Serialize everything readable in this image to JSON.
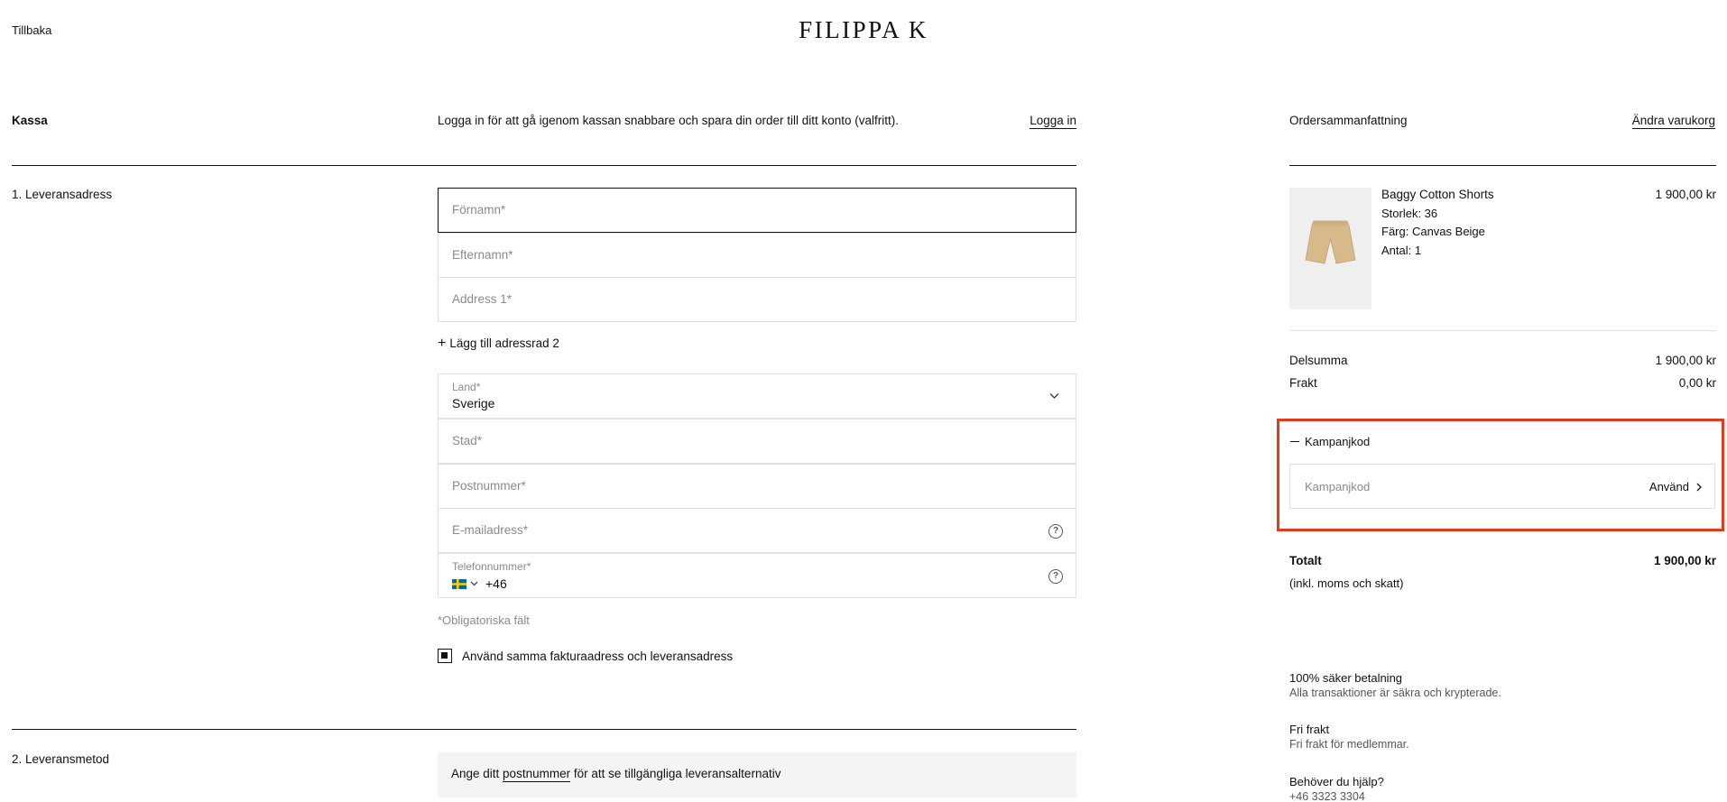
{
  "header": {
    "back_label": "Tillbaka",
    "brand": "FILIPPA K"
  },
  "checkout": {
    "title": "Kassa",
    "login_prompt": "Logga in för att gå igenom kassan snabbare och spara din order till ditt konto (valfritt).",
    "login_link": "Logga in"
  },
  "shipping_address": {
    "section_title": "1. Leveransadress",
    "first_name_placeholder": "Förnamn*",
    "last_name_placeholder": "Efternamn*",
    "address1_placeholder": "Address 1*",
    "add_address2_label": "Lägg till adressrad 2",
    "country_label": "Land*",
    "country_value": "Sverige",
    "city_placeholder": "Stad*",
    "postal_placeholder": "Postnummer*",
    "email_placeholder": "E-mailadress*",
    "phone_label": "Telefonnummer*",
    "phone_prefix": "+46",
    "required_note": "*Obligatoriska fält",
    "same_address_label": "Använd samma fakturaadress och leveransadress",
    "same_address_checked": true
  },
  "delivery_method": {
    "section_title": "2. Leveransmetod",
    "notice_before": "Ange ditt ",
    "notice_link": "postnummer",
    "notice_after": " för att se tillgängliga leveransalternativ"
  },
  "order_summary": {
    "title": "Ordersammanfattning",
    "edit_cart_link": "Ändra varukorg",
    "item": {
      "name": "Baggy Cotton Shorts",
      "size": "Storlek: 36",
      "color": "Färg: Canvas Beige",
      "quantity": "Antal: 1",
      "price": "1 900,00 kr"
    },
    "subtotal_label": "Delsumma",
    "subtotal_value": "1 900,00 kr",
    "shipping_label": "Frakt",
    "shipping_value": "0,00 kr",
    "promo_toggle_label": "Kampanjkod",
    "promo_placeholder": "Kampanjkod",
    "promo_apply_label": "Använd",
    "total_label": "Totalt",
    "total_value": "1 900,00 kr",
    "total_note": "(inkl. moms och skatt)"
  },
  "info": {
    "secure_title": "100% säker betalning",
    "secure_text": "Alla transaktioner är säkra och krypterade.",
    "free_shipping_title": "Fri frakt",
    "free_shipping_text": "Fri frakt för medlemmar.",
    "help_title": "Behöver du hjälp?",
    "help_phone": "+46 3323 3304"
  },
  "colors": {
    "highlight": "#e23b1c",
    "text": "#111111",
    "muted": "#8a8a8a"
  }
}
